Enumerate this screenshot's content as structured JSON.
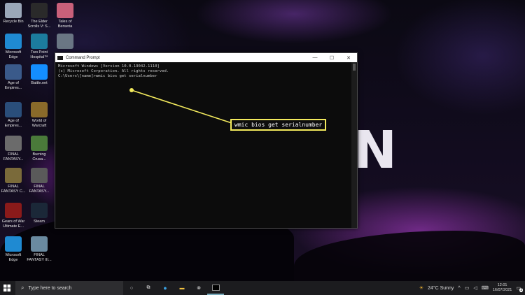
{
  "desktop": {
    "wallpaper_letter": "N",
    "icons": [
      {
        "label": "Recycle Bin",
        "icon": "recycle-bin-icon",
        "color": "#9aa7b8"
      },
      {
        "label": "The Elder\nScrolls V: S...",
        "icon": "elder-scrolls-icon",
        "color": "#2a2a2a"
      },
      {
        "label": "Tales of\nBerseria",
        "icon": "tales-of-berseria-icon",
        "color": "#c8607a"
      },
      {
        "label": "Microsoft\nEdge",
        "icon": "edge-icon",
        "color": "#1f8ad2"
      },
      {
        "label": "Two Point\nHospital™",
        "icon": "two-point-hospital-icon",
        "color": "#1c7c9e"
      },
      {
        "label": "",
        "icon": "game-icon",
        "color": "#6a7684"
      },
      {
        "label": "Age of\nEmpires...",
        "icon": "age-of-empires-icon",
        "color": "#3a5a8a"
      },
      {
        "label": "Battle.net",
        "icon": "battlenet-icon",
        "color": "#148eff"
      },
      {
        "label": "Age of\nEmpires...",
        "icon": "age-of-empires-icon",
        "color": "#2a4e7a"
      },
      {
        "label": "World of\nWarcraft",
        "icon": "world-of-warcraft-icon",
        "color": "#8a6a2a"
      },
      {
        "label": "FINAL\nFANTASY...",
        "icon": "final-fantasy-icon",
        "color": "#6b6b6b"
      },
      {
        "label": "Burning\nCrusa...",
        "icon": "burning-crusade-icon",
        "color": "#4a7a3a"
      },
      {
        "label": "FINAL\nFANTASY C...",
        "icon": "final-fantasy-icon",
        "color": "#7a6a3a"
      },
      {
        "label": "FINAL\nFANTASY...",
        "icon": "final-fantasy-icon",
        "color": "#5a5a5a"
      },
      {
        "label": "Gears of War\nUltimate E...",
        "icon": "gears-of-war-icon",
        "color": "#8a1a1a"
      },
      {
        "label": "Steam",
        "icon": "steam-icon",
        "color": "#1b2838"
      },
      {
        "label": "Microsoft\nEdge",
        "icon": "edge-icon",
        "color": "#1f8ad2"
      },
      {
        "label": "FINAL\nFANTASY III...",
        "icon": "final-fantasy-icon",
        "color": "#6a8aa0"
      }
    ]
  },
  "cmd_window": {
    "title": "Command Prompt",
    "minimize": "—",
    "maximize": "☐",
    "close": "✕",
    "lines": [
      "Microsoft Windows [Version 10.0.19042.1110]",
      "(c) Microsoft Corporation. All rights reserved.",
      "",
      "C:\\Users\\[name]>wmic bios get serialnumber"
    ]
  },
  "callout": {
    "text": "wmic bios get serialnumber",
    "color": "#f3ea5d"
  },
  "taskbar": {
    "search_placeholder": "Type here to search",
    "weather": "24°C  Sunny",
    "time": "12:01",
    "date": "16/07/2021",
    "notification_count": "3"
  }
}
